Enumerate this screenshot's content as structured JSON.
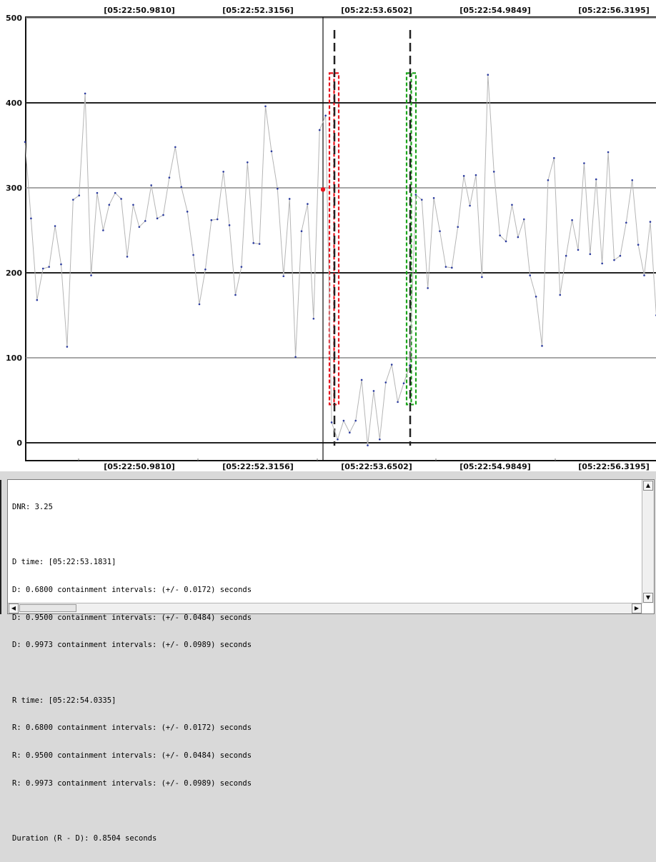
{
  "chart_data": {
    "type": "line",
    "ylim": [
      0,
      500
    ],
    "y_ticks": [
      0,
      100,
      200,
      300,
      400,
      500
    ],
    "time_ticks": [
      "[05:22:50.9810]",
      "[05:22:52.3156]",
      "[05:22:53.6502]",
      "[05:22:54.9849]",
      "[05:22:56.3195]"
    ],
    "grid": true,
    "series": [
      {
        "values": [
          354,
          264,
          168,
          205,
          207,
          255,
          210,
          113,
          286,
          291,
          411,
          197,
          294,
          250,
          280,
          294,
          287,
          219,
          280,
          254,
          261,
          303,
          264,
          268,
          312,
          348,
          301,
          272,
          221,
          163,
          204,
          262,
          263,
          319,
          256,
          174,
          207,
          330,
          235,
          234,
          396,
          343,
          299,
          196,
          287,
          101,
          249,
          281,
          146,
          368,
          385,
          24,
          4,
          26,
          12,
          26,
          74,
          -3,
          61,
          4,
          71,
          92,
          48,
          70,
          91,
          292,
          286,
          182,
          288,
          249,
          207,
          206,
          254,
          314,
          279,
          315,
          195,
          433,
          319,
          244,
          237,
          280,
          242,
          263,
          197,
          172,
          114,
          309,
          335,
          174,
          220,
          262,
          227,
          329,
          222,
          310,
          211,
          342,
          215,
          220,
          259,
          309,
          233,
          197,
          260,
          150
        ]
      }
    ],
    "cursor_marker_value": 298,
    "colors": {
      "line": "#b5b5b5",
      "point": "#2a3a9e",
      "marker": "#e8141c",
      "d_interval": "#e8141c",
      "r_interval": "#1aa31a",
      "bar_marker": "#222222"
    }
  },
  "log_lines": [
    "DNR: 3.25",
    "",
    "D time: [05:22:53.1831]",
    "D: 0.6800 containment intervals: (+/- 0.0172) seconds",
    "D: 0.9500 containment intervals: (+/- 0.0484) seconds",
    "D: 0.9973 containment intervals: (+/- 0.0989) seconds",
    "",
    "R time: [05:22:54.0335]",
    "R: 0.6800 containment intervals: (+/- 0.0172) seconds",
    "R: 0.9500 containment intervals: (+/- 0.0484) seconds",
    "R: 0.9973 containment intervals: (+/- 0.0989) seconds",
    "",
    "Duration (R - D): 0.8504 seconds"
  ],
  "icons": {
    "scroll_up": "▲",
    "scroll_down": "▼",
    "scroll_left": "◀",
    "scroll_right": "▶"
  }
}
